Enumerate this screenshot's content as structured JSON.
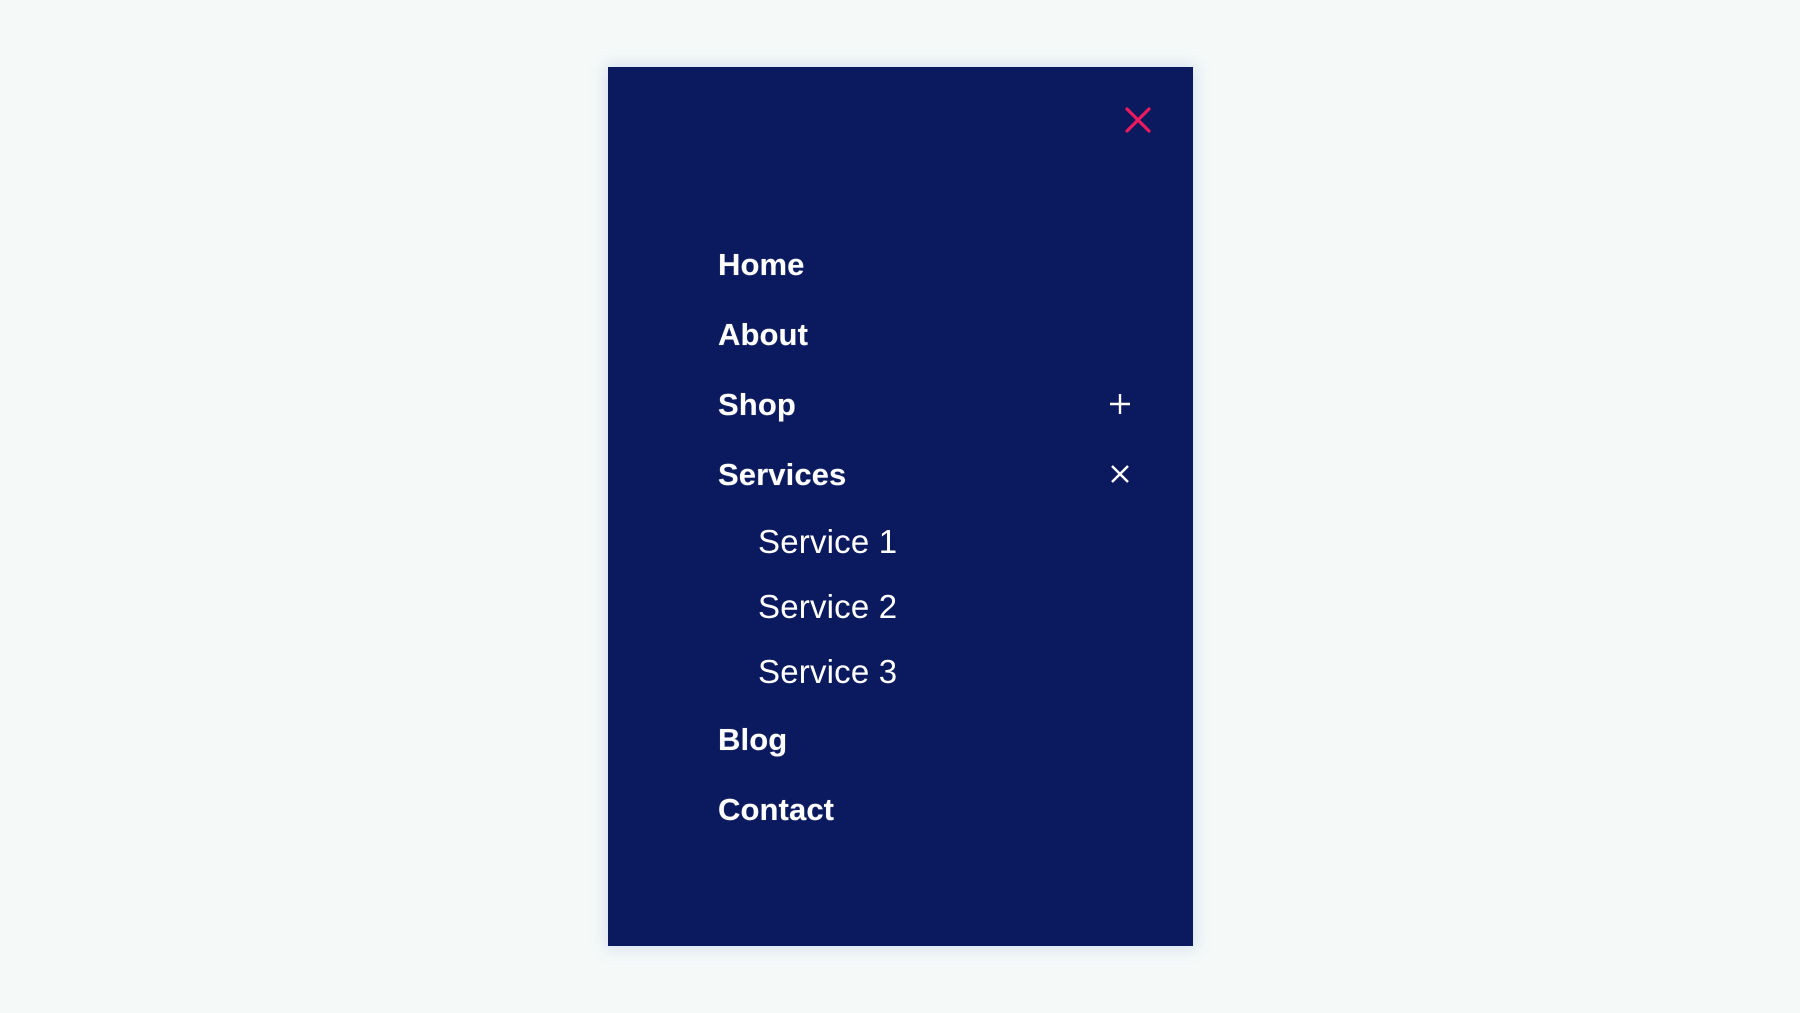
{
  "panel": {
    "background_color": "#0b1a5e",
    "page_background_color": "#f5f9f8"
  },
  "close_button": {
    "name": "close-menu",
    "icon": "close-x-icon",
    "color": "#ee1a5f",
    "label": "Close menu"
  },
  "nav": {
    "items": [
      {
        "label": "Home",
        "has_toggle": false,
        "toggle_icon": "",
        "expanded": false,
        "children": []
      },
      {
        "label": "About",
        "has_toggle": false,
        "toggle_icon": "",
        "expanded": false,
        "children": []
      },
      {
        "label": "Shop",
        "has_toggle": true,
        "toggle_icon": "plus-icon",
        "expanded": false,
        "children": []
      },
      {
        "label": "Services",
        "has_toggle": true,
        "toggle_icon": "close-x-icon",
        "expanded": true,
        "children": [
          {
            "label": "Service 1"
          },
          {
            "label": "Service 2"
          },
          {
            "label": "Service 3"
          }
        ]
      },
      {
        "label": "Blog",
        "has_toggle": false,
        "toggle_icon": "",
        "expanded": false,
        "children": []
      },
      {
        "label": "Contact",
        "has_toggle": false,
        "toggle_icon": "",
        "expanded": false,
        "children": []
      }
    ],
    "toggle_icon_color": "#ffffff",
    "label_color": "#ffffff"
  }
}
